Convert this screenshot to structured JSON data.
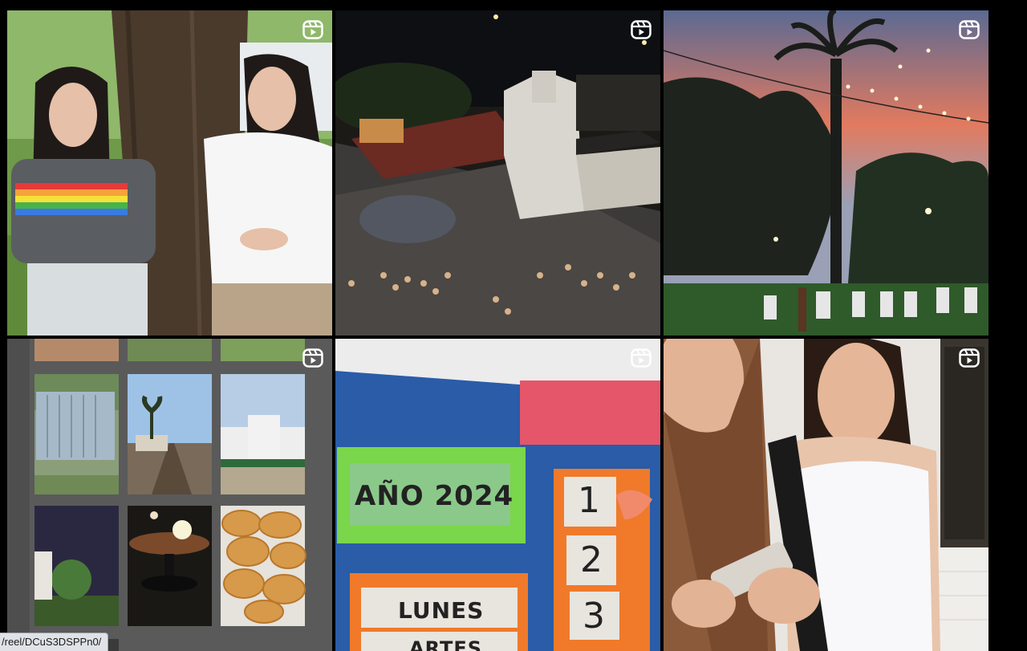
{
  "status_bar": {
    "url": "/reel/DCuS3DSPPn0/"
  },
  "posts": [
    {
      "type": "reel",
      "icon": "reel-icon",
      "scene": "two-girls-under-tree"
    },
    {
      "type": "reel",
      "icon": "reel-icon",
      "scene": "night-aerial-station-fair"
    },
    {
      "type": "reel",
      "icon": "reel-icon",
      "scene": "sunset-palm-string-lights"
    },
    {
      "type": "reel",
      "icon": "reel-icon",
      "scene": "photo-collage-grid"
    },
    {
      "type": "reel",
      "icon": "reel-icon",
      "scene": "school-schedule-board",
      "board": {
        "year_label": "AÑO 2024",
        "day1": "LUNES",
        "day2": "ARTES",
        "numbers": [
          "1",
          "2",
          "3"
        ]
      }
    },
    {
      "type": "reel",
      "icon": "reel-icon",
      "scene": "girls-with-phone"
    }
  ],
  "colors": {
    "background": "#000000",
    "icon": "#ffffff"
  }
}
